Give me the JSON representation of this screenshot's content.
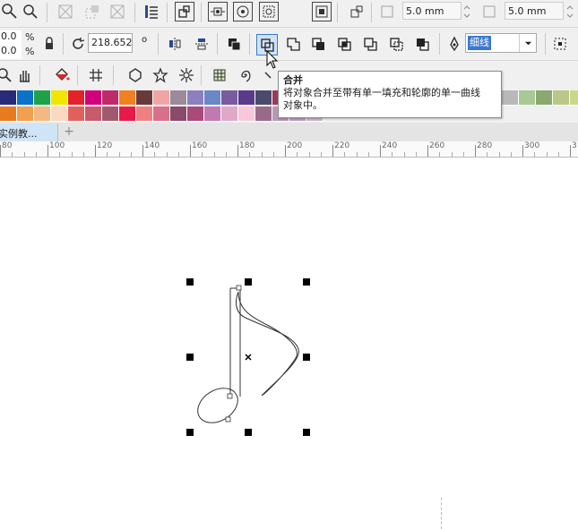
{
  "toolbar1": {
    "outline_width_1": "5.0 mm",
    "outline_width_2": "5.0 mm"
  },
  "property_bar": {
    "scale_x": "0.0",
    "scale_y": "0.0",
    "pct": "%",
    "rotation": "218.652",
    "rotation_unit": "o",
    "line_style": "细线"
  },
  "tooltip": {
    "title": "合并",
    "line1": "将对象合并至带有单一填充和轮廓的单一曲线",
    "line2": "对象中。"
  },
  "tab": {
    "label": "实例教...",
    "add": "+"
  },
  "ruler": {
    "ticks": [
      "80",
      "100",
      "120",
      "140",
      "160",
      "180",
      "200",
      "220",
      "240",
      "260",
      "280",
      "300",
      "3"
    ]
  },
  "palette": {
    "row1": [
      "#2a2a7a",
      "#0a72c8",
      "#1fa14a",
      "#f2e600",
      "#e2242a",
      "#d2007a",
      "#c12a6a",
      "#f08020",
      "#6a3a3a",
      "#f2a3a3",
      "#9a8a9a",
      "#8a80c0",
      "#6a88c8",
      "#7a5aa0",
      "#5a3a8a",
      "#4a4a6a",
      "#9a3a5a",
      "#b0c8e0",
      "#c0c0c0"
    ],
    "row2": [
      "#e87a20",
      "#f0a050",
      "#f4b880",
      "#fcd8c0",
      "#e06060",
      "#c85a6a",
      "#a05a70",
      "#e81a4a",
      "#f08080",
      "#d8708a",
      "#8a4a6a",
      "#a84a7a",
      "#c07ab0",
      "#e0a8c8",
      "#f8c8d8",
      "#9a6a8a",
      "#b898b8",
      "#c0a0c0",
      "#d0b8d0"
    ],
    "row1_right": [
      "#b8b8b8",
      "#a8c898",
      "#8aa870",
      "#b8c888",
      "#c8d888",
      "#a0b878"
    ],
    "row2_right": []
  }
}
